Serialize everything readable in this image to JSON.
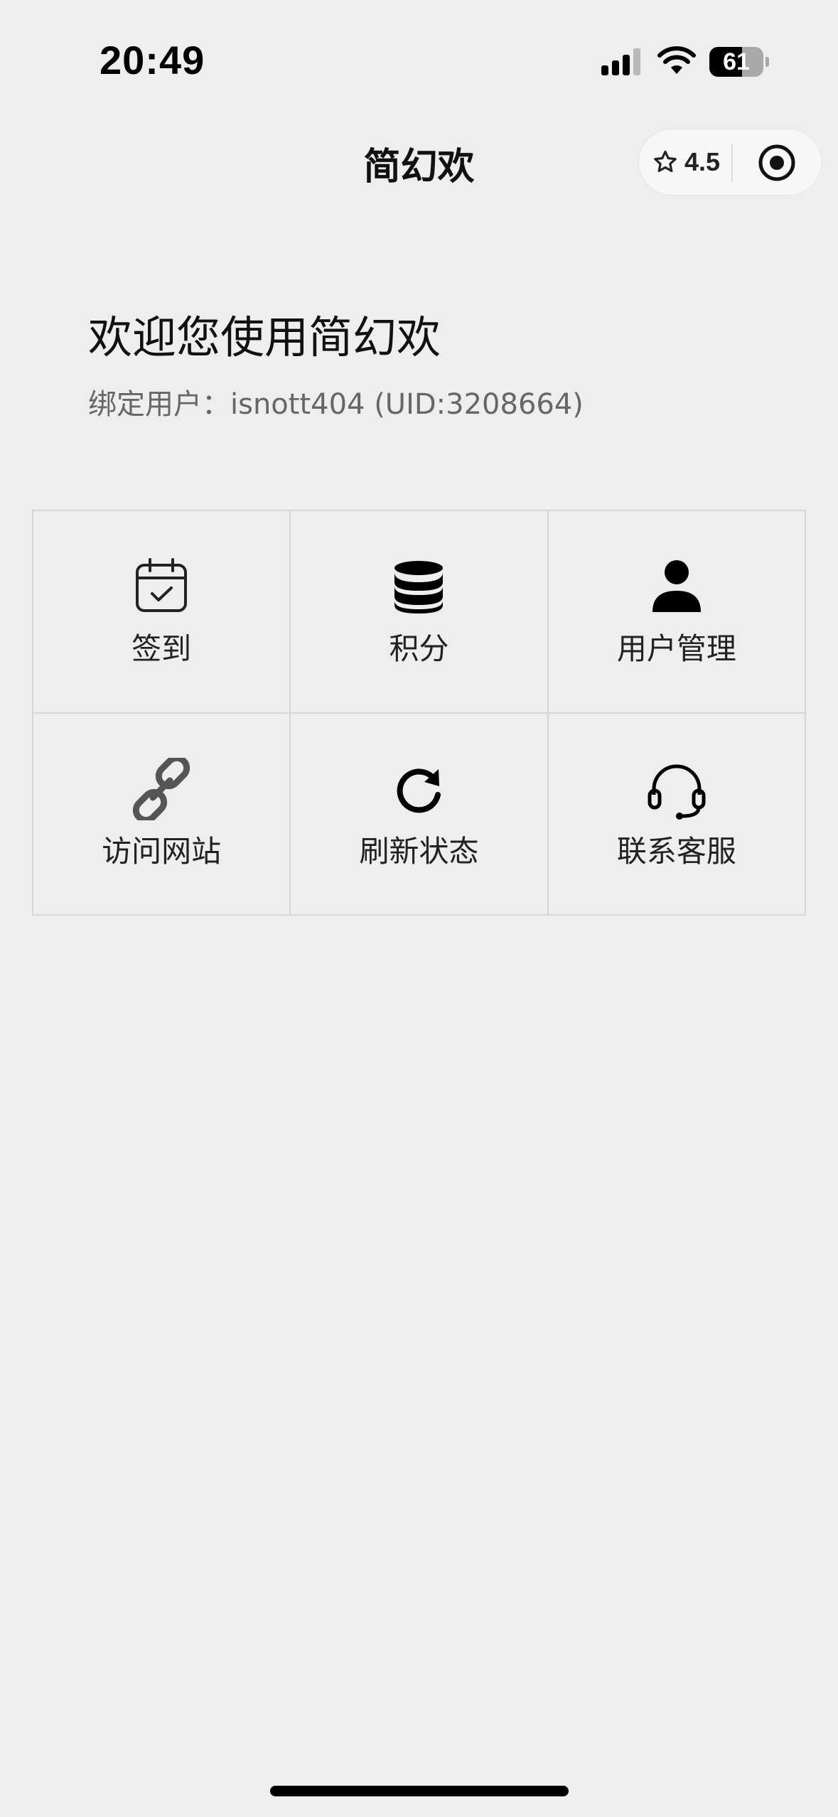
{
  "status_bar": {
    "time": "20:49",
    "battery_percent": 61,
    "battery_label": "61",
    "signal_icon": "signal-icon",
    "wifi_icon": "wifi-icon"
  },
  "nav": {
    "title": "简幻欢",
    "rating": "4.5",
    "rating_icon": "star-outline-icon",
    "capsule_icon": "target-icon"
  },
  "welcome": {
    "title": "欢迎您使用简幻欢",
    "bound_user": "绑定用户：isnott404 (UID:3208664)"
  },
  "menu": [
    {
      "label": "签到",
      "icon": "calendar-check-icon"
    },
    {
      "label": "积分",
      "icon": "database-icon"
    },
    {
      "label": "用户管理",
      "icon": "user-icon"
    },
    {
      "label": "访问网站",
      "icon": "link-icon"
    },
    {
      "label": "刷新状态",
      "icon": "refresh-icon"
    },
    {
      "label": "联系客服",
      "icon": "headset-icon"
    }
  ],
  "colors": {
    "background": "#eeeeee",
    "grid_border": "#d6d6d6",
    "text": "#111111",
    "muted_text": "#666666"
  }
}
